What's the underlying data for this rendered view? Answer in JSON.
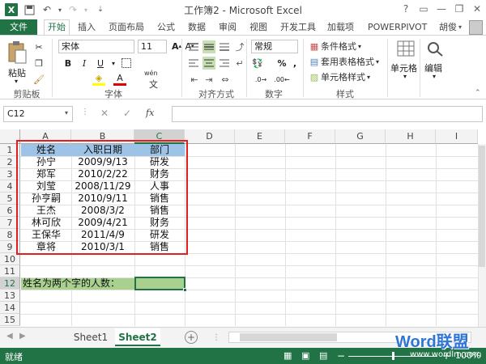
{
  "titlebar": {
    "title": "工作簿2 - Microsoft Excel",
    "help": "?",
    "minimize": "—",
    "restore": "❐",
    "close": "✕"
  },
  "ribbon_tabs": {
    "file": "文件",
    "items": [
      "开始",
      "插入",
      "页面布局",
      "公式",
      "数据",
      "审阅",
      "视图",
      "开发工具",
      "加载项",
      "POWERPIVOT"
    ],
    "active": "开始",
    "user": "胡俊"
  },
  "clipboard": {
    "paste": "粘贴",
    "label": "剪贴板"
  },
  "font": {
    "name": "宋体",
    "size": "11",
    "bold": "B",
    "italic": "I",
    "underline": "U",
    "font_color": "A",
    "wen": "wén",
    "label": "字体"
  },
  "alignment": {
    "label": "对齐方式"
  },
  "number": {
    "format": "常规",
    "label": "数字",
    "percent": "%",
    "comma": ","
  },
  "styles": {
    "cond": "条件格式",
    "table": "套用表格格式",
    "cell": "单元格样式",
    "label": "样式"
  },
  "cells": {
    "label": "单元格"
  },
  "editing": {
    "label": "编辑"
  },
  "formula_bar": {
    "name_box": "C12",
    "fx": "fx",
    "cancel": "✕",
    "enter": "✓",
    "value": ""
  },
  "columns": [
    "A",
    "B",
    "C",
    "D",
    "E",
    "F",
    "G",
    "H",
    "I"
  ],
  "rows": [
    "1",
    "2",
    "3",
    "4",
    "5",
    "6",
    "7",
    "8",
    "9",
    "10",
    "11",
    "12",
    "13",
    "14",
    "15",
    "16"
  ],
  "table": {
    "headers": [
      "姓名",
      "入职日期",
      "部门"
    ],
    "rows": [
      [
        "孙宁",
        "2009/9/13",
        "研发"
      ],
      [
        "郑军",
        "2010/2/22",
        "财务"
      ],
      [
        "刘莹",
        "2008/11/29",
        "人事"
      ],
      [
        "孙亨嗣",
        "2010/9/11",
        "销售"
      ],
      [
        "王杰",
        "2008/3/2",
        "销售"
      ],
      [
        "林可欣",
        "2009/4/21",
        "财务"
      ],
      [
        "王保华",
        "2011/4/9",
        "研发"
      ],
      [
        "章将",
        "2010/3/1",
        "销售"
      ]
    ]
  },
  "question_label": "姓名为两个字的人数：",
  "sheets": {
    "tabs": [
      "Sheet1",
      "Sheet2"
    ],
    "active": "Sheet2",
    "add": "+"
  },
  "status": {
    "ready": "就绪",
    "zoom": "100%"
  },
  "watermark": {
    "brand": "Word联盟",
    "url": "www.wordlm.com"
  },
  "colors": {
    "accent": "#217346",
    "header_fill": "#9dc3e6",
    "question_fill": "#a9d08e",
    "highlight_border": "#e02020"
  }
}
